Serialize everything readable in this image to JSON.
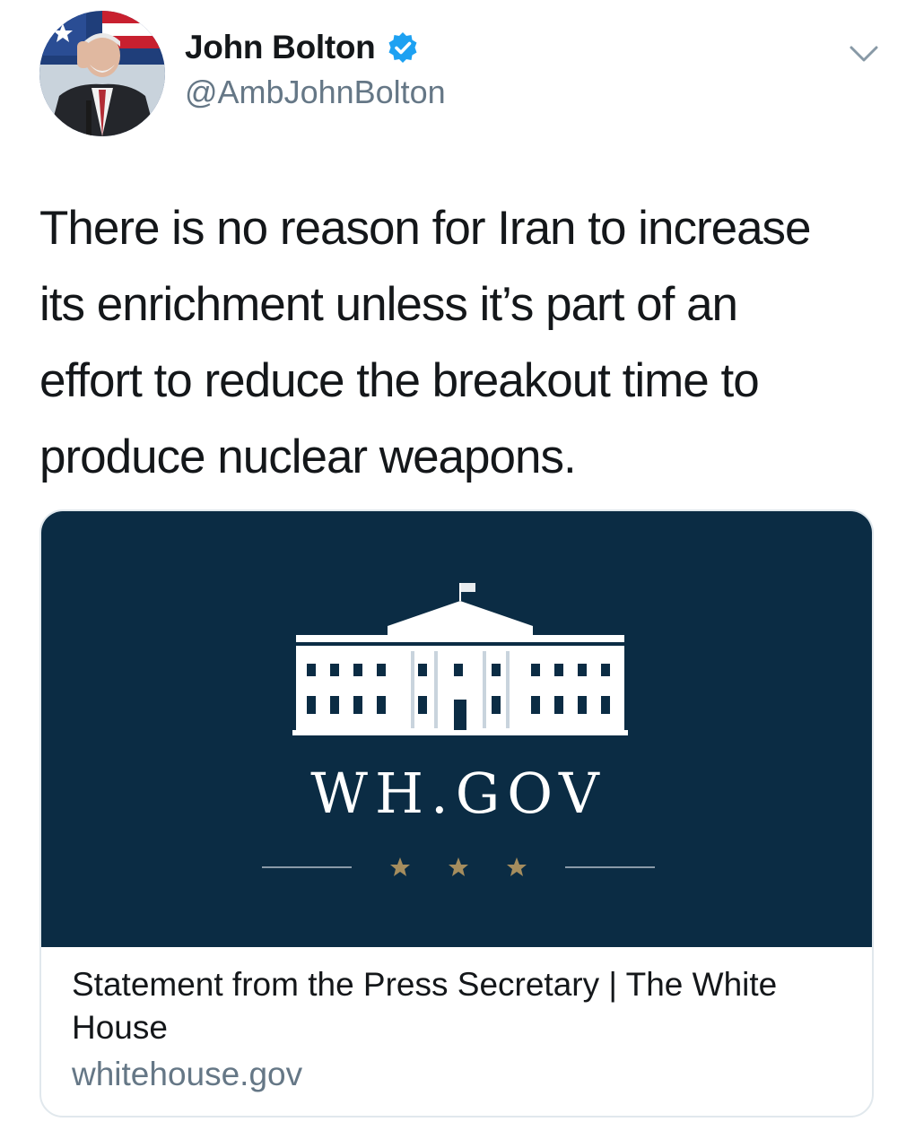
{
  "author": {
    "display_name": "John Bolton",
    "handle": "@AmbJohnBolton",
    "verified": true,
    "avatar_icon": "profile-photo"
  },
  "tweet": {
    "text": "There is no reason for Iran to increase\nits enrichment unless it’s part of an\neffort to reduce the breakout time to\nproduce nuclear weapons."
  },
  "card": {
    "image_wordmark": "WH.GOV",
    "image_icon": "white-house-icon",
    "title": "Statement from the Press Secretary | The White House",
    "domain": "whitehouse.gov"
  },
  "colors": {
    "verified_blue": "#1da1f2",
    "card_navy": "#0b2c44",
    "star_gold": "#a58d5e",
    "secondary_text": "#657786"
  }
}
